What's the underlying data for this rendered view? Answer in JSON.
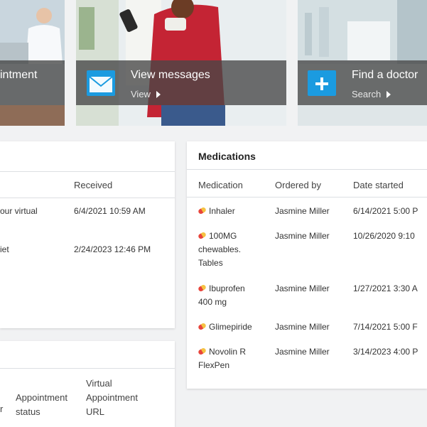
{
  "tiles": {
    "appointment": {
      "title": "intment"
    },
    "messages": {
      "title": "View messages",
      "sub": "View"
    },
    "doctor": {
      "title": "Find a doctor",
      "sub": "Search"
    }
  },
  "messages_card": {
    "col_received": "Received",
    "rows": [
      {
        "subject": "our virtual",
        "received": "6/4/2021 10:59 AM"
      },
      {
        "subject": "iet",
        "received": "2/24/2023 12:46 PM"
      }
    ]
  },
  "appointments_card": {
    "col_partial": "r",
    "col_status": "Appointment status",
    "col_url_1": "Virtual",
    "col_url_2": "Appointment",
    "col_url_3": "URL"
  },
  "medications": {
    "title": "Medications",
    "columns": [
      "Medication",
      "Ordered by",
      "Date started"
    ],
    "rows": [
      {
        "name": "Inhaler",
        "name2": "",
        "name3": "",
        "ordered_by": "Jasmine Miller",
        "date": "6/14/2021 5:00 P"
      },
      {
        "name": "100MG",
        "name2": "chewables.",
        "name3": "Tables",
        "ordered_by": "Jasmine Miller",
        "date": "10/26/2020 9:10"
      },
      {
        "name": "Ibuprofen",
        "name2": "400 mg",
        "name3": "",
        "ordered_by": "Jasmine Miller",
        "date": "1/27/2021 3:30 A"
      },
      {
        "name": "Glimepiride",
        "name2": "",
        "name3": "",
        "ordered_by": "Jasmine Miller",
        "date": "7/14/2021 5:00 F"
      },
      {
        "name": "Novolin R",
        "name2": "FlexPen",
        "name3": "",
        "ordered_by": "Jasmine Miller",
        "date": "3/14/2023 4:00 P"
      }
    ]
  },
  "colors": {
    "accent": "#1b9be0",
    "overlay": "#464646"
  }
}
